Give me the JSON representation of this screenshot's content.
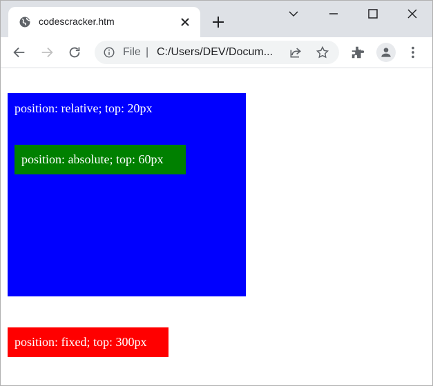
{
  "browser": {
    "tab": {
      "title": "codescracker.htm"
    },
    "address_bar": {
      "scheme_label": "File",
      "separator": "|",
      "url": "C:/Users/DEV/Docum..."
    }
  },
  "page": {
    "relative_box": {
      "text": "position: relative; top: 20px",
      "color": "#0000ff"
    },
    "absolute_box": {
      "text": "position: absolute; top: 60px",
      "color": "#008000"
    },
    "fixed_box": {
      "text": "position: fixed; top: 300px",
      "color": "#ff0000"
    }
  },
  "icons": [
    "globe-icon",
    "close-icon",
    "plus-icon",
    "chevron-down-icon",
    "minimize-icon",
    "maximize-icon",
    "window-close-icon",
    "back-icon",
    "forward-icon",
    "reload-icon",
    "info-icon",
    "share-icon",
    "star-icon",
    "extensions-icon",
    "profile-icon",
    "menu-icon"
  ]
}
